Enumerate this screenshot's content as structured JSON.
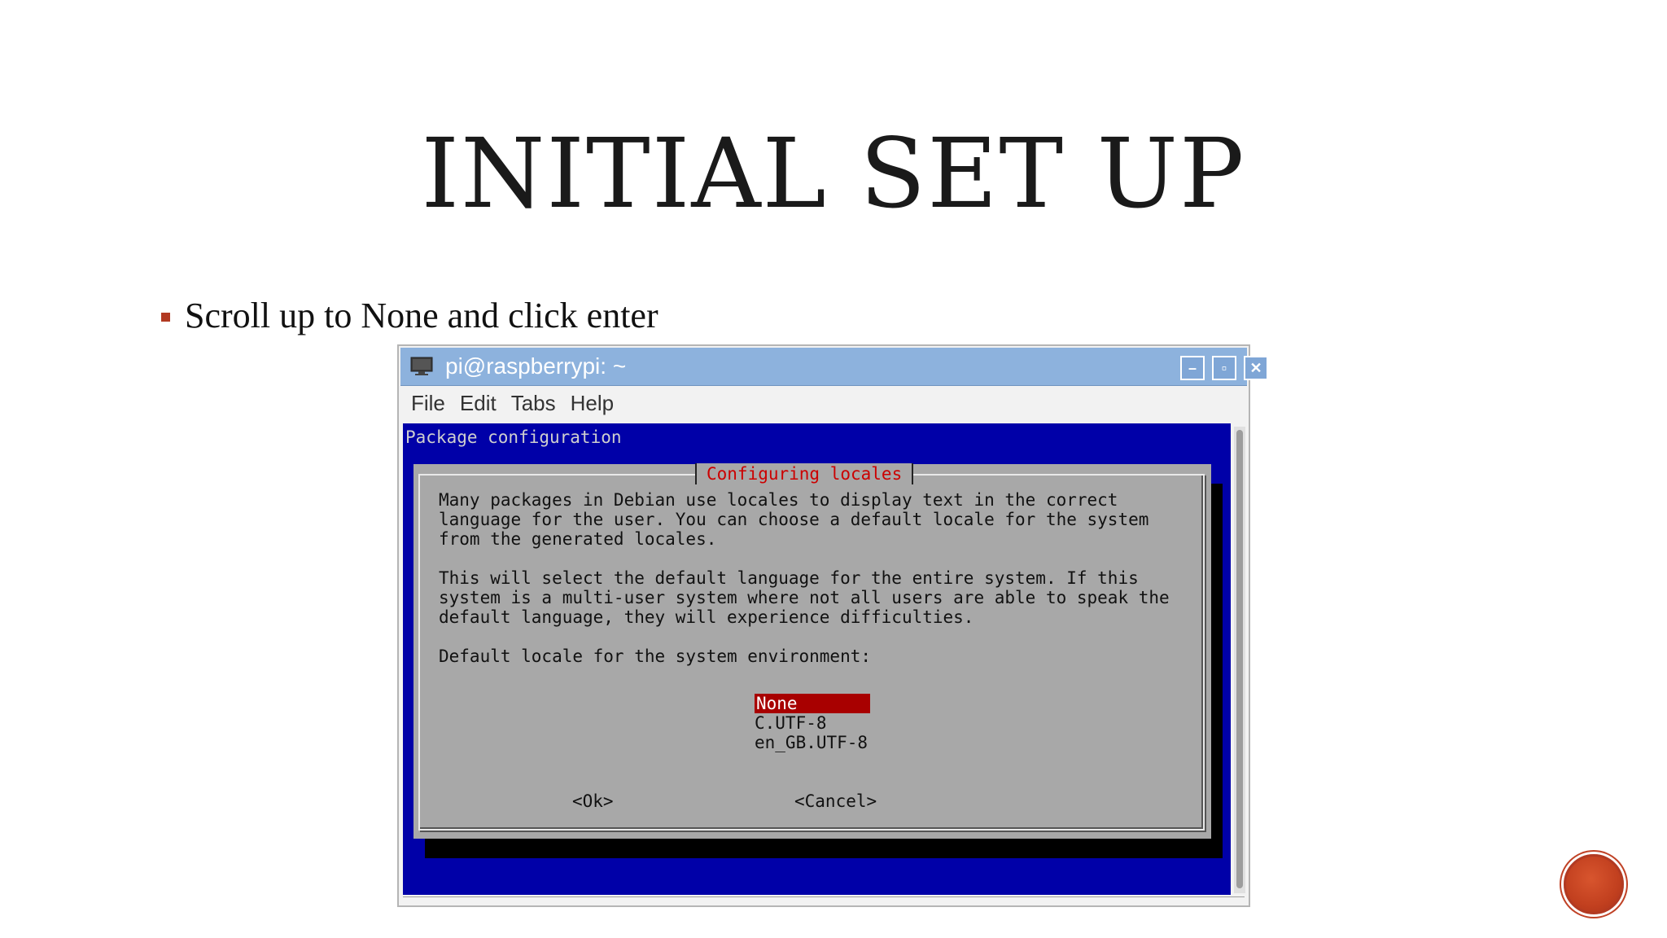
{
  "slide": {
    "title": "INITIAL SET UP",
    "bullet": "Scroll up to None and click enter"
  },
  "window": {
    "title": "pi@raspberrypi: ~",
    "controls": {
      "minimize": "–",
      "maximize": "▫",
      "close": "✕"
    },
    "menu": [
      "File",
      "Edit",
      "Tabs",
      "Help"
    ]
  },
  "terminal": {
    "header": "Package configuration",
    "dialog": {
      "title": "Configuring locales",
      "body": [
        "Many packages in Debian use locales to display text in the correct",
        "language for the user. You can choose a default locale for the system",
        "from the generated locales.",
        "",
        "This will select the default language for the entire system. If this",
        "system is a multi-user system where not all users are able to speak the",
        "default language, they will experience difficulties.",
        "",
        "Default locale for the system environment:"
      ],
      "options": [
        "None",
        "C.UTF-8",
        "en_GB.UTF-8"
      ],
      "selected": "None",
      "ok": "<Ok>",
      "cancel": "<Cancel>"
    }
  },
  "colors": {
    "terminal_bg": "#0000a8",
    "dialog_bg": "#a8a8a8",
    "dialog_title": "#cc0000",
    "selection": "#a80000",
    "titlebar": "#8db2dd",
    "accent": "#b23a22"
  }
}
